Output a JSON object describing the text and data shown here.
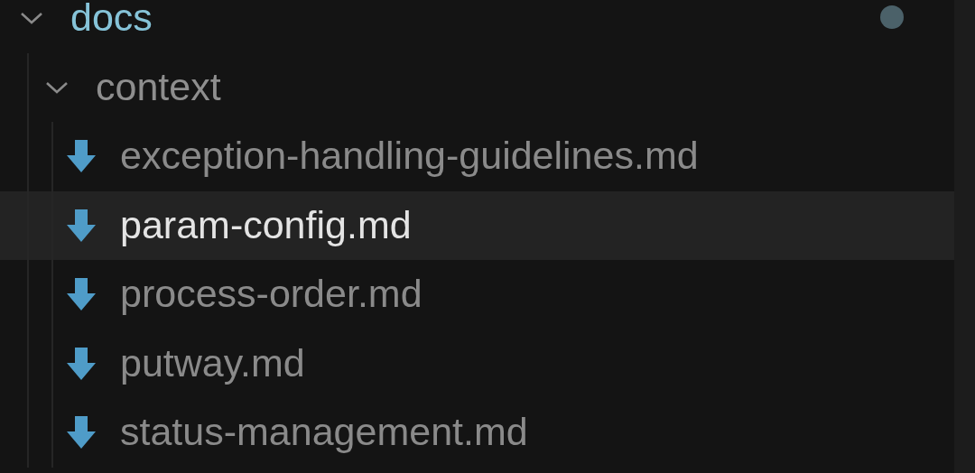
{
  "explorer": {
    "tree": [
      {
        "name": "docs",
        "kind": "folder",
        "expanded": true,
        "modified": true,
        "children": [
          {
            "name": "context",
            "kind": "folder",
            "expanded": true,
            "modified": false,
            "children": [
              {
                "name": "exception-handling-guidelines.md",
                "kind": "file",
                "selected": false
              },
              {
                "name": "param-config.md",
                "kind": "file",
                "selected": true
              },
              {
                "name": "process-order.md",
                "kind": "file",
                "selected": false
              },
              {
                "name": "putway.md",
                "kind": "file",
                "selected": false
              },
              {
                "name": "status-management.md",
                "kind": "file",
                "selected": false
              }
            ]
          }
        ]
      }
    ]
  }
}
